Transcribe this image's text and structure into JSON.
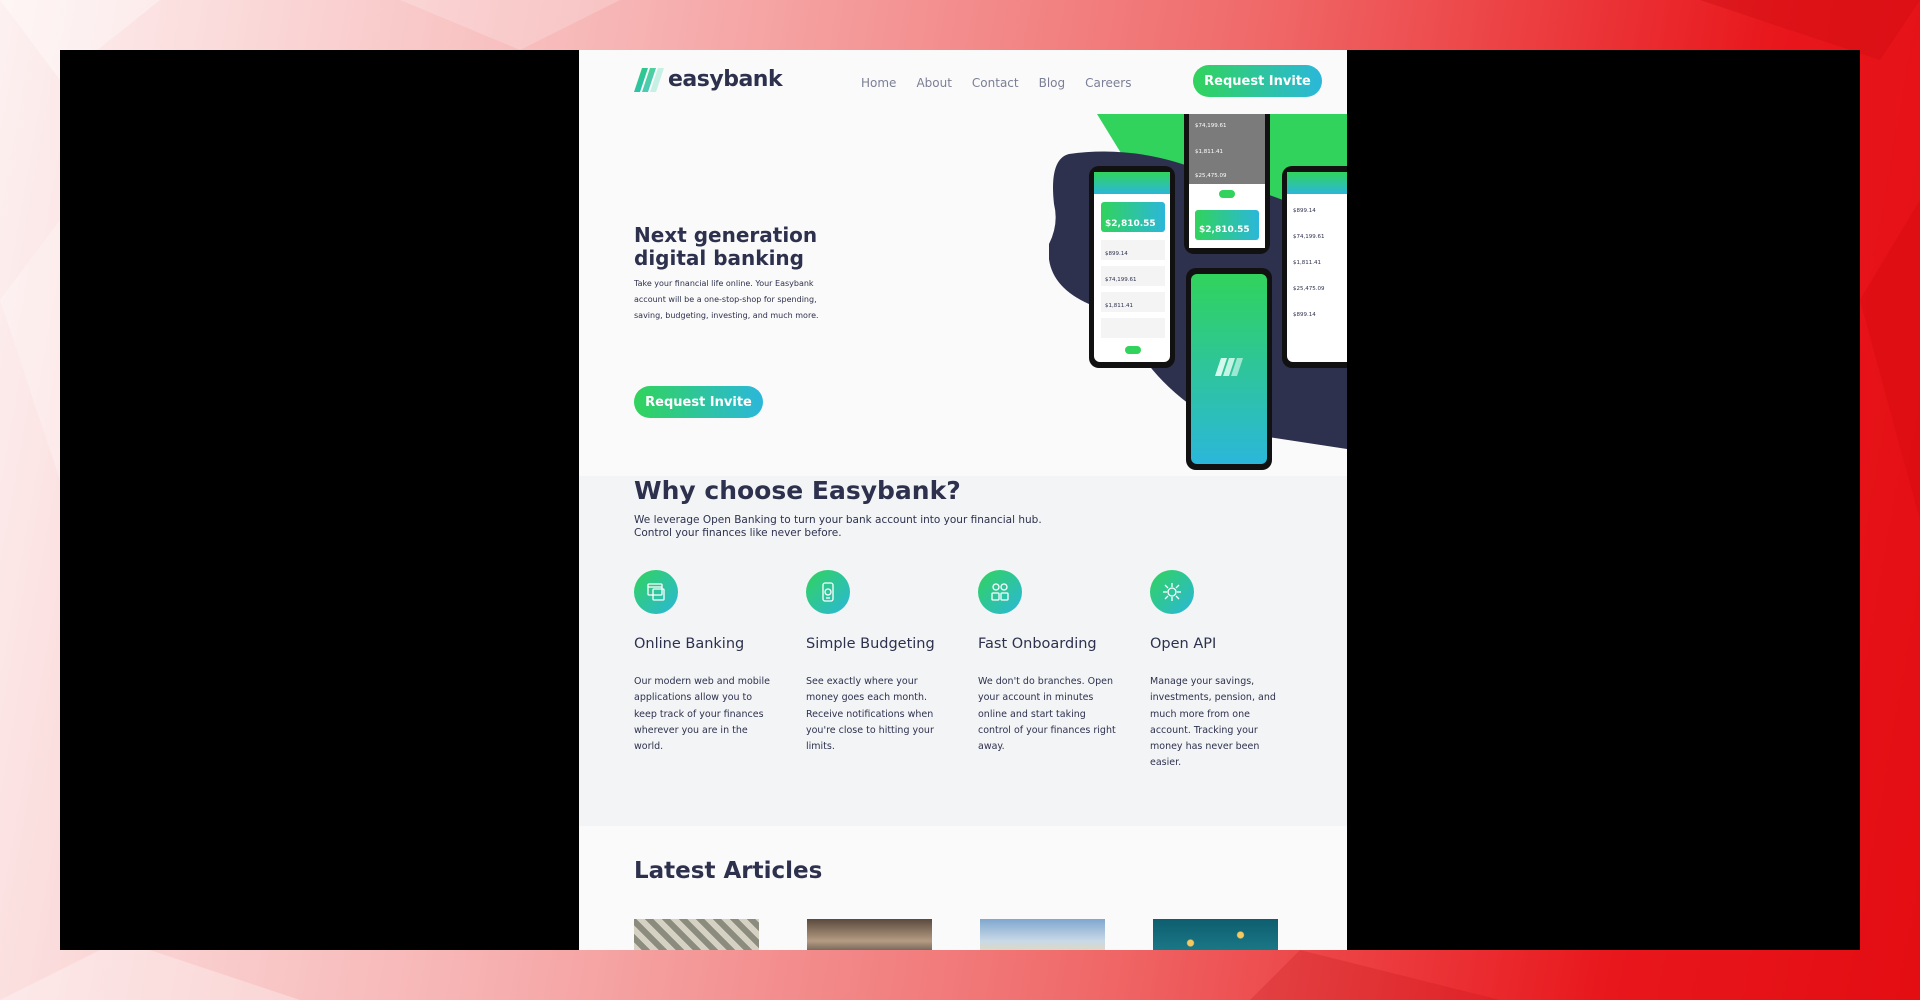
{
  "header": {
    "logo_text": "easybank",
    "nav": [
      "Home",
      "About",
      "Contact",
      "Blog",
      "Careers"
    ],
    "cta_label": "Request Invite"
  },
  "hero": {
    "title": "Next generation digital banking",
    "text": "Take your financial life online. Your Easybank account will be a one-stop-shop for spending, saving, budgeting, investing, and much more.",
    "cta_label": "Request Invite",
    "phone_amounts": [
      "$2,810.55",
      "$899.14",
      "$74,199.61",
      "$1,811.41",
      "$25,475.09"
    ]
  },
  "why": {
    "title": "Why choose Easybank?",
    "subtitle": "We leverage Open Banking to turn your bank account into your financial hub. Control your finances like never before.",
    "features": [
      {
        "icon": "online-banking-icon",
        "title": "Online Banking",
        "text": "Our modern web and mobile applications allow you to keep track of your finances wherever you are in the world."
      },
      {
        "icon": "budgeting-icon",
        "title": "Simple Budgeting",
        "text": "See exactly where your money goes each month. Receive notifications when you're close to hitting your limits."
      },
      {
        "icon": "onboarding-icon",
        "title": "Fast Onboarding",
        "text": "We don't do branches. Open your account in minutes online and start taking control of your finances right away."
      },
      {
        "icon": "api-icon",
        "title": "Open API",
        "text": "Manage your savings, investments, pension, and much more from one account. Tracking your money has never been easier."
      }
    ]
  },
  "articles": {
    "title": "Latest Articles"
  },
  "colors": {
    "accent_green": "#31d35c",
    "accent_cyan": "#2bb7da",
    "dark_blue": "#2d314d"
  }
}
